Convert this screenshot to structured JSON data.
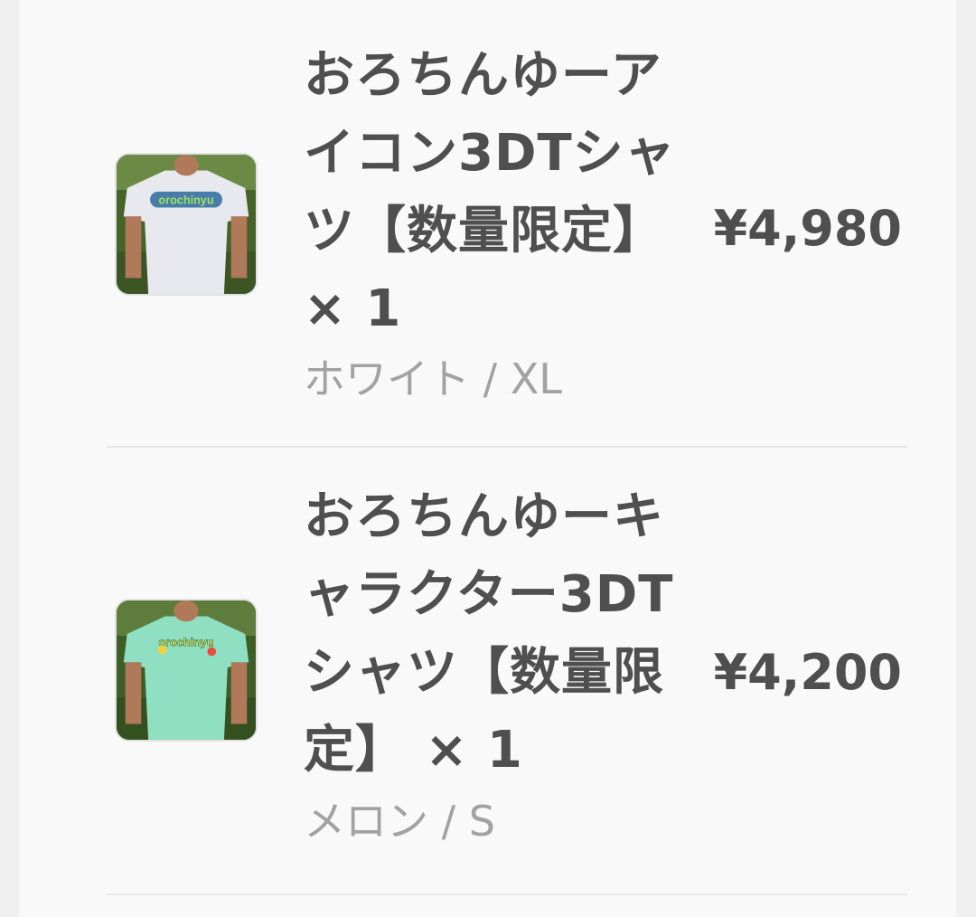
{
  "cart": {
    "items": [
      {
        "title": "おろちんゆーアイコン3DTシャツ【数量限定】 × 1",
        "variant": "ホワイト / XL",
        "price": "¥4,980",
        "shirt_color": "#e7e9ee",
        "image_logo_text": "orochinyu"
      },
      {
        "title": "おろちんゆーキャラクター3DTシャツ【数量限定】 × 1",
        "variant": "メロン / S",
        "price": "¥4,200",
        "shirt_color": "#8fe0c2",
        "image_logo_text": "orochinyu"
      }
    ]
  },
  "colors": {
    "text_primary": "#4f4f4f",
    "text_secondary": "#a2a2a2",
    "divider": "#e6e6e6",
    "panel": "#f9f9f9"
  }
}
